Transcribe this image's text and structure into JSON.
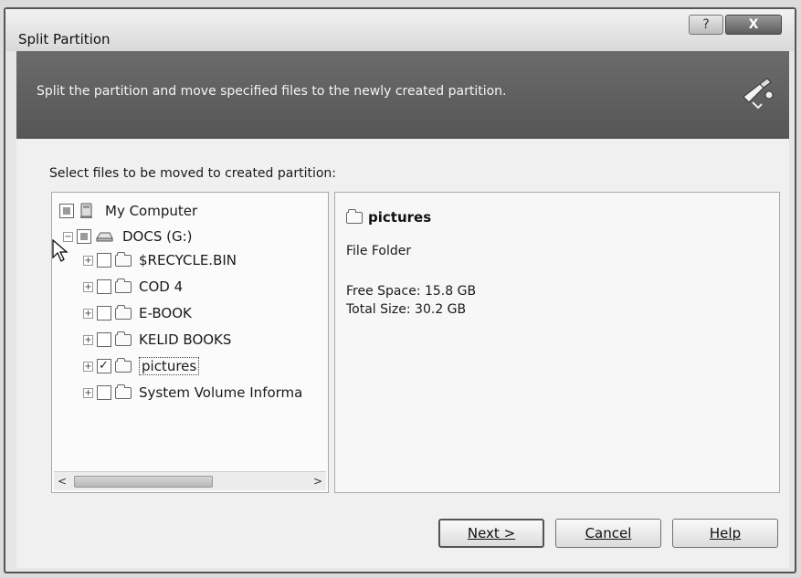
{
  "window": {
    "title": "Split Partition",
    "help_glyph": "?",
    "close_glyph": "X"
  },
  "banner": {
    "text": "Split the partition and move specified files to the newly created partition.",
    "icon": "wizard-icon"
  },
  "prompt": "Select files to be moved to created partition:",
  "tree": {
    "root": {
      "label": "My Computer",
      "icon": "computer-icon",
      "check": "partial"
    },
    "drive": {
      "label": "DOCS (G:)",
      "icon": "drive-icon",
      "check": "partial",
      "expanded": true
    },
    "folders": [
      {
        "label": "$RECYCLE.BIN",
        "checked": false
      },
      {
        "label": "COD 4",
        "checked": false
      },
      {
        "label": "E-BOOK",
        "checked": false
      },
      {
        "label": "KELID BOOKS",
        "checked": false
      },
      {
        "label": "pictures",
        "checked": true,
        "selected": true
      },
      {
        "label": "System Volume Informa",
        "checked": false
      }
    ],
    "scroll_left_glyph": "<",
    "scroll_right_glyph": ">"
  },
  "details": {
    "name": "pictures",
    "type": "File Folder",
    "free_space": "Free Space: 15.8 GB",
    "total_size": "Total Size: 30.2 GB"
  },
  "buttons": {
    "next": "Next >",
    "cancel": "Cancel",
    "help": "Help"
  }
}
